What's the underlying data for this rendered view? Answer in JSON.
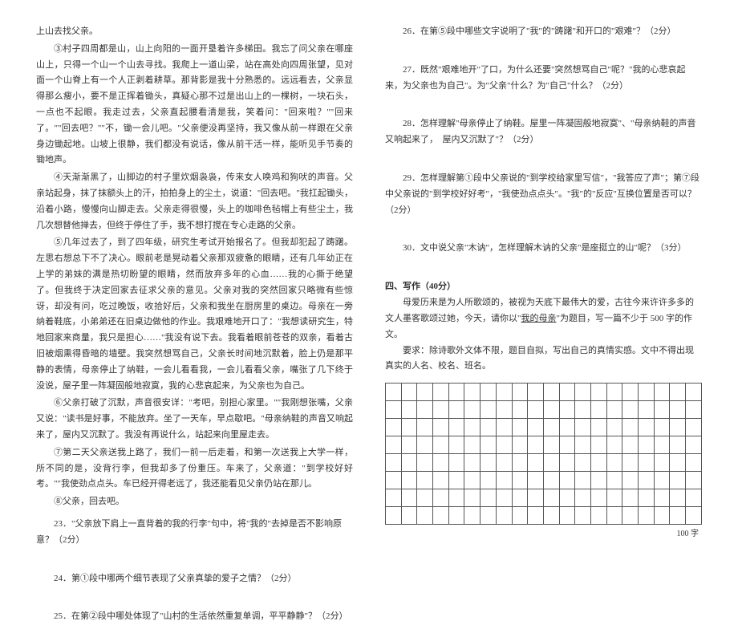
{
  "left": {
    "title_line": "上山去找父亲。",
    "p3": "③村子四周都是山，山上向阳的一面开垦着许多梯田。我忘了问父亲在哪座山上，只得一个山一个山去寻找。我爬上一道山梁，站在高处向四周张望，见对面一个山脊上有一个人正剥着耕草。那背影是我十分熟悉的。远远看去，父亲显得那么瘦小，要不是正挥着锄头，真疑心那不过是出山上的一棵树，一块石头，一点也不起眼。我走过去，父亲直起腰看清是我，笑着问：\"回来啦？\"\"回来了。\"\"回去吧？\"\"不，锄一会儿吧。\"父亲便没再坚持，我又像从前一样跟在父亲身边锄起地。山坡上很静，我们都没有说话，像从前干活一样，能听见手节奏的锄地声。",
    "p4": "④天渐渐黑了，山脚边的村子里炊烟袅袅，传来女人唤鸡和狗吠的声音。父亲站起身，抹了抹额头上的汗，拍拍身上的尘土，说道：\"回去吧。\"我扛起锄头，沿着小路，慢慢向山脚走去。父亲走得很慢，头上的咖啡色毡帽上有些尘土，我几次想替他掸去，但终于停住了手，我不想打搅在专心走路的父亲。",
    "p5": "⑤几年过去了，到了四年级，研究生考试开始报名了。但我却犯起了踌躇。左思右想总下不了决心。眼前老是晃动着父亲那双疲惫的眼睛，还有几年幼正在上学的弟妹的满是热切盼望的眼睛，然而放弃多年的心血……我的心撕于绝望了。但我终于决定回家去征求父亲的意见。父亲对我的突然回家只略微有些惊讶，却没有问，吃过晚饭，收拾好后，父亲和我坐在厨房里的桌边。母亲在一旁纳着鞋底，小弟弟还在旧桌边做他的作业。我艰难地开口了：\"我想读研究生，特地回家来商量，我只是担心……\"我没有说下去。我看着眼前苍苍的双亲，看着古旧被烟熏得昏暗的墙壁。我突然想骂自己，父亲长时间地沉默着，脸上仍是那平静的表情，母亲停止了纳鞋，一会儿看看我，一会儿看看父亲，嘴张了几下终于没说，屋子里一阵凝固般地寂寞，我的心悲哀起来，为父亲也为自己。",
    "p6": "⑥父亲打破了沉默，声音很安详：\"考吧，别担心家里。\"\"我刚想张嘴，父亲又说：\"读书是好事，不能放弃。坐了一天车，早点歇吧。\"母亲纳鞋的声音又响起来了，屋内又沉默了。我没有再说什么，站起来向里屋走去。",
    "p7": "⑦第二天父亲送我上路了，我们一前一后走着，和第一次送我上大学一样，所不同的是，没背行李，但我却多了份重压。车来了，父亲道：\"到学校好好考。\"\"我使劲点点头。车已经开得老远了，我还能看见父亲仍站在那儿。",
    "p8": "⑧父亲，回去吧。",
    "q23": "23．\"父亲放下肩上一直背着的我的行李\"句中，将\"我的\"去掉是否不影响原意？（2分）",
    "q24": "24．第①段中哪两个细节表现了父亲真挚的爱子之情？（2分）",
    "q25": "25．在第②段中哪处体现了\"山村的生活依然重复单调，平平静静\"？（2分）"
  },
  "right": {
    "q26": "26．在第⑤段中哪些文字说明了\"我\"的\"踌躇\"和开口的\"艰难\"？（2分）",
    "q27": "27．既然\"艰难地开\"了口，为什么还要\"突然想骂自己\"呢？\"我的心悲哀起来，为父亲也为自己\"。为\"父亲\"什么？为\"自己\"什么？（2分）",
    "q28": "28．怎样理解\"母亲停止了纳鞋。屋里一阵凝固般地寂寞\"、\"母亲纳鞋的声音又响起来了，　屋内又沉默了\"？（2分）",
    "q29": "29．怎样理解第①段中父亲说的\"到学校给家里写信\"，\"我答应了声\"；第⑦段中父亲说的\"到学校好好考\"，\"我使劲点点头\"。\"我\"的\"反应\"互换位置是否可以？　（2分）",
    "q30": "30．文中说父亲\"木讷\"，怎样理解木讷的父亲\"是座挺立的山\"呢？（3分）",
    "section": "四、写作（40分）",
    "essay_p1": "母爱历来是为人所歌颂的，被视为天底下最伟大的爱，古往今来许许多多的文人墨客歌颂过她，今天，请你以\"",
    "essay_topic": "我的母亲",
    "essay_p1b": "\"为题目，写一篇不少于 500 字的作文。",
    "essay_p2": "要求：除诗歌外文体不限，题目自拟，写出自己的真情实感。文中不得出现真实的人名、校名、班名。",
    "grid_label": "100 字"
  }
}
